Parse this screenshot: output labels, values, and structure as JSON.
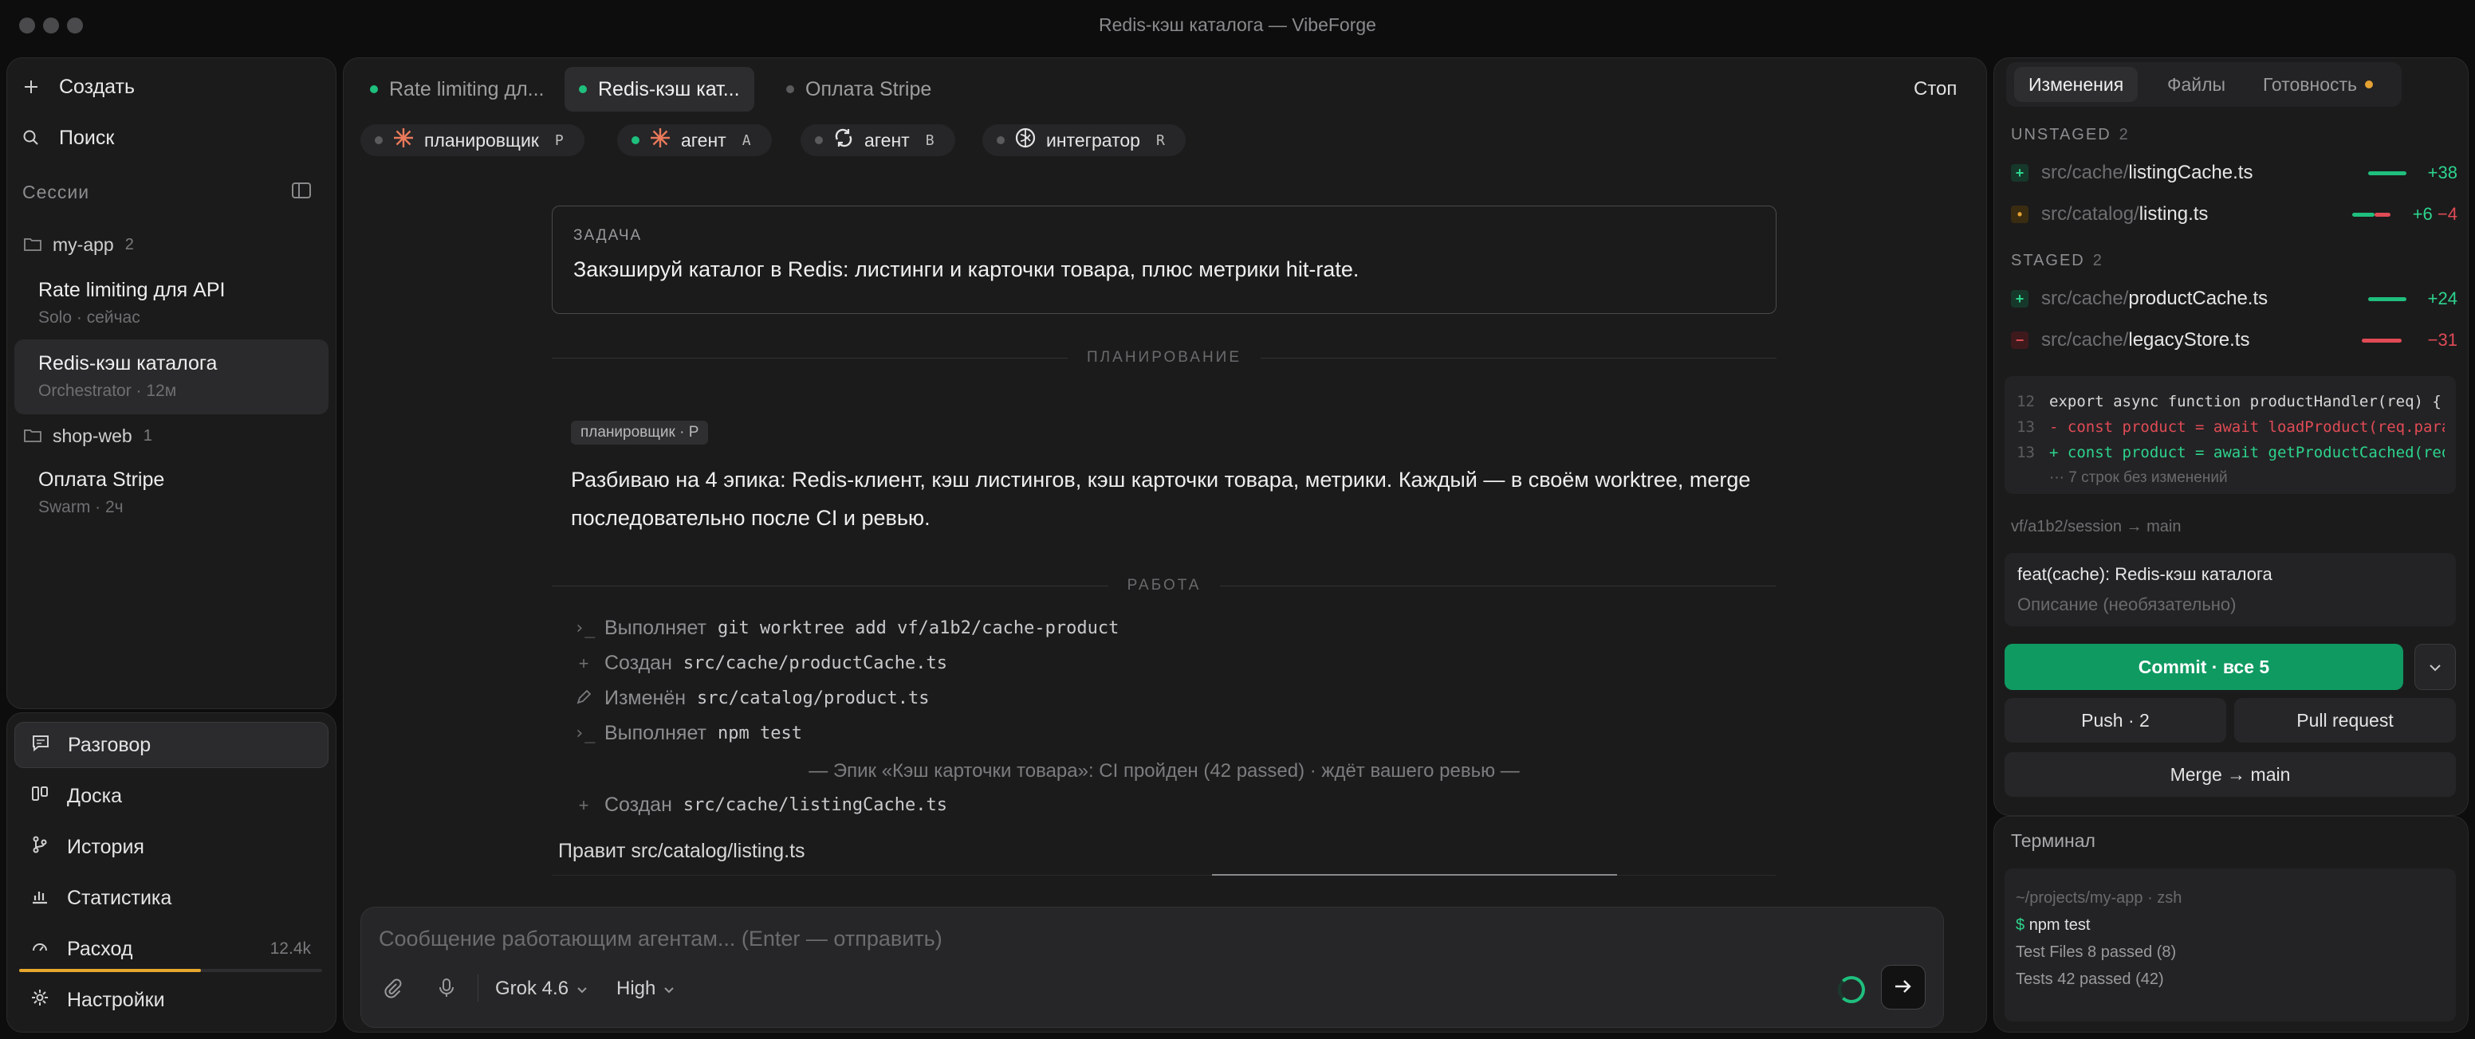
{
  "window": {
    "title": "Redis-кэш каталога — VibeForge"
  },
  "sidebar": {
    "create_label": "Создать",
    "search_label": "Поиск",
    "sessions_label": "Сессии",
    "projects": [
      {
        "name": "my-app",
        "count": "2"
      },
      {
        "name": "shop-web",
        "count": "1"
      }
    ],
    "sessions": [
      {
        "title": "Rate limiting для API",
        "subtitle": "Solo · сейчас"
      },
      {
        "title": "Redis-кэш каталога",
        "subtitle": "Orchestrator · 12м"
      },
      {
        "title": "Оплата Stripe",
        "subtitle": "Swarm · 2ч"
      }
    ],
    "nav": [
      {
        "label": "Разговор",
        "icon": "chat-icon"
      },
      {
        "label": "Доска",
        "icon": "board-icon"
      },
      {
        "label": "История",
        "icon": "history-icon"
      },
      {
        "label": "Статистика",
        "icon": "stats-icon"
      },
      {
        "label": "Расход",
        "icon": "gauge-icon",
        "value": "12.4k"
      },
      {
        "label": "Настройки",
        "icon": "gear-icon"
      }
    ],
    "spend_progress": 0.6
  },
  "main": {
    "tabs": [
      {
        "label": "Rate limiting дл...",
        "status": "green"
      },
      {
        "label": "Redis-кэш кат...",
        "status": "green"
      },
      {
        "label": "Оплата Stripe",
        "status": "gray"
      }
    ],
    "stop_label": "Стоп",
    "agents": [
      {
        "label": "планировщик",
        "key": "P",
        "status": "gray",
        "icon": "sparkle-icon"
      },
      {
        "label": "агент",
        "key": "A",
        "status": "green",
        "icon": "sparkle-icon"
      },
      {
        "label": "агент",
        "key": "B",
        "status": "gray",
        "icon": "cycle-icon"
      },
      {
        "label": "интегратор",
        "key": "R",
        "status": "gray",
        "icon": "knot-icon"
      }
    ],
    "task": {
      "label": "ЗАДАЧА",
      "text": "Закэшируй каталог в Redis: листинги и карточки товара, плюс метрики hit-rate."
    },
    "planning_label": "ПЛАНИРОВАНИЕ",
    "plan": {
      "badge": "планировщик · P",
      "text": "Разбиваю на 4 эпика: Redis-клиент, кэш листингов, кэш карточки товара, метрики. Каждый — в своём worktree, merge последовательно после CI и ревью."
    },
    "work_label": "РАБОТА",
    "work": [
      {
        "icon": "terminal-icon",
        "action": "Выполняет",
        "detail": "git worktree add vf/a1b2/cache-product"
      },
      {
        "icon": "plus-icon",
        "action": "Создан",
        "detail": "src/cache/productCache.ts"
      },
      {
        "icon": "pencil-icon",
        "action": "Изменён",
        "detail": "src/catalog/product.ts"
      },
      {
        "icon": "terminal-icon",
        "action": "Выполняет",
        "detail": "npm test"
      }
    ],
    "epic_note": "— Эпик «Кэш карточки товара»: CI пройден (42 passed) · ждёт вашего ревью —",
    "work_after": {
      "icon": "plus-icon",
      "action": "Создан",
      "detail": "src/cache/listingCache.ts"
    },
    "editing": "Правит src/catalog/listing.ts",
    "composer": {
      "placeholder": "Сообщение работающим агентам... (Enter — отправить)",
      "model": "Grok 4.6",
      "effort": "High"
    }
  },
  "changes": {
    "tabs": [
      {
        "label": "Изменения"
      },
      {
        "label": "Файлы"
      },
      {
        "label": "Готовность"
      }
    ],
    "unstaged_label": "UNSTAGED",
    "unstaged_count": "2",
    "staged_label": "STAGED",
    "staged_count": "2",
    "unstaged": [
      {
        "path": "src/cache/",
        "name": "listingCache.ts",
        "type": "add",
        "added": "+38",
        "removed": ""
      },
      {
        "path": "src/catalog/",
        "name": "listing.ts",
        "type": "mod",
        "added": "+6",
        "removed": "−4"
      }
    ],
    "staged": [
      {
        "path": "src/cache/",
        "name": "productCache.ts",
        "type": "add",
        "added": "+24",
        "removed": ""
      },
      {
        "path": "src/cache/",
        "name": "legacyStore.ts",
        "type": "del",
        "added": "",
        "removed": "−31"
      }
    ],
    "diff": [
      {
        "ln": "12",
        "text": "export async function productHandler(req) {",
        "kind": "ctx"
      },
      {
        "ln": "13",
        "text": "- const product = await loadProduct(req.params....",
        "kind": "del"
      },
      {
        "ln": "13",
        "text": "+ const product = await getProductCached(req....",
        "kind": "add"
      },
      {
        "ln": "",
        "text": "··· 7 строк без изменений",
        "kind": "fold"
      }
    ],
    "branch": "vf/a1b2/session  →  main",
    "commit_title": "feat(cache): Redis-кэш каталога",
    "commit_desc_placeholder": "Описание (необязательно)",
    "commit_button": "Commit · все 5",
    "push_button": "Push · 2",
    "pr_button": "Pull request",
    "merge_button": "Merge → main"
  },
  "terminal": {
    "title": "Терминал",
    "lines": [
      {
        "text": "~/projects/my-app · zsh",
        "kind": "dim"
      },
      {
        "prompt": "$",
        "text": "npm test",
        "kind": "cmd"
      },
      {
        "text": "Test Files 8 passed (8)",
        "kind": "out"
      },
      {
        "text": "Tests 42 passed (42)",
        "kind": "out"
      }
    ]
  },
  "colors": {
    "accent": "#1fbf7e",
    "commit": "#0f9a62",
    "added": "#2dd48d",
    "removed": "#e04b55",
    "warning": "#e3a233"
  }
}
